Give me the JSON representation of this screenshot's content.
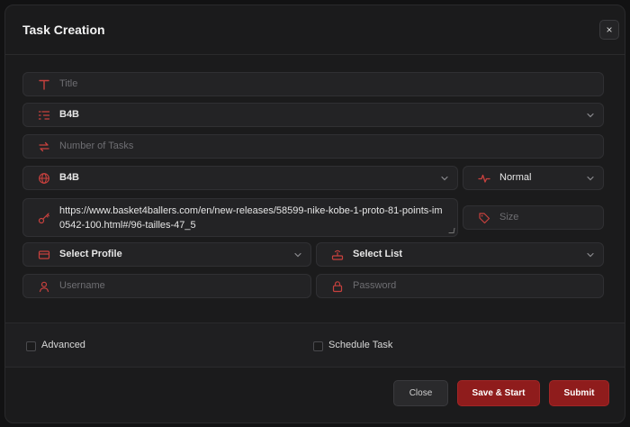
{
  "header": {
    "title": "Task Creation",
    "close_symbol": "×"
  },
  "form": {
    "title_placeholder": "Title",
    "site": "B4B",
    "tasks_placeholder": "Number of Tasks",
    "region": "B4B",
    "mode": "Normal",
    "url": "https://www.basket4ballers.com/en/new-releases/58599-nike-kobe-1-proto-81-points-im0542-100.html#/96-tailles-47_5",
    "size_placeholder": "Size",
    "profile": "Select Profile",
    "list": "Select List",
    "username_placeholder": "Username",
    "password_placeholder": "Password"
  },
  "options": {
    "advanced": "Advanced",
    "schedule": "Schedule Task"
  },
  "footer": {
    "close": "Close",
    "save_start": "Save & Start",
    "submit": "Submit"
  },
  "colors": {
    "accent": "#c8413e",
    "button": "#8f1c1c"
  }
}
